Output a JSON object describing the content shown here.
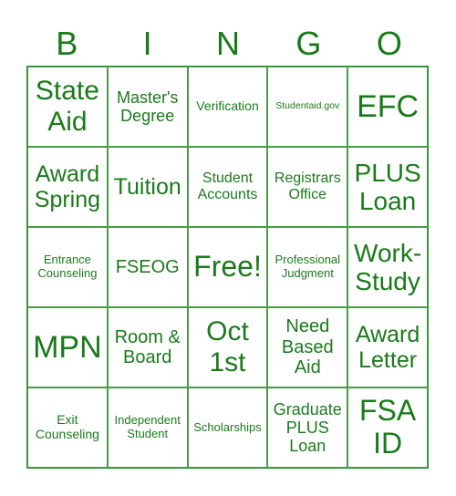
{
  "header": [
    "B",
    "I",
    "N",
    "G",
    "O"
  ],
  "accent_color": "#1a7a1a",
  "cells": [
    [
      "State Aid",
      "Master's Degree",
      "Verification",
      "Studentaid.gov",
      "EFC"
    ],
    [
      "Award Spring",
      "Tuition",
      "Student Accounts",
      "Registrars Office",
      "PLUS Loan"
    ],
    [
      "Entrance Counseling",
      "FSEOG",
      "Free!",
      "Professional Judgment",
      "Work-Study"
    ],
    [
      "MPN",
      "Room & Board",
      "Oct 1st",
      "Need Based Aid",
      "Award Letter"
    ],
    [
      "Exit Counseling",
      "Independent Student",
      "Scholarships",
      "Graduate PLUS Loan",
      "FSA ID"
    ]
  ]
}
